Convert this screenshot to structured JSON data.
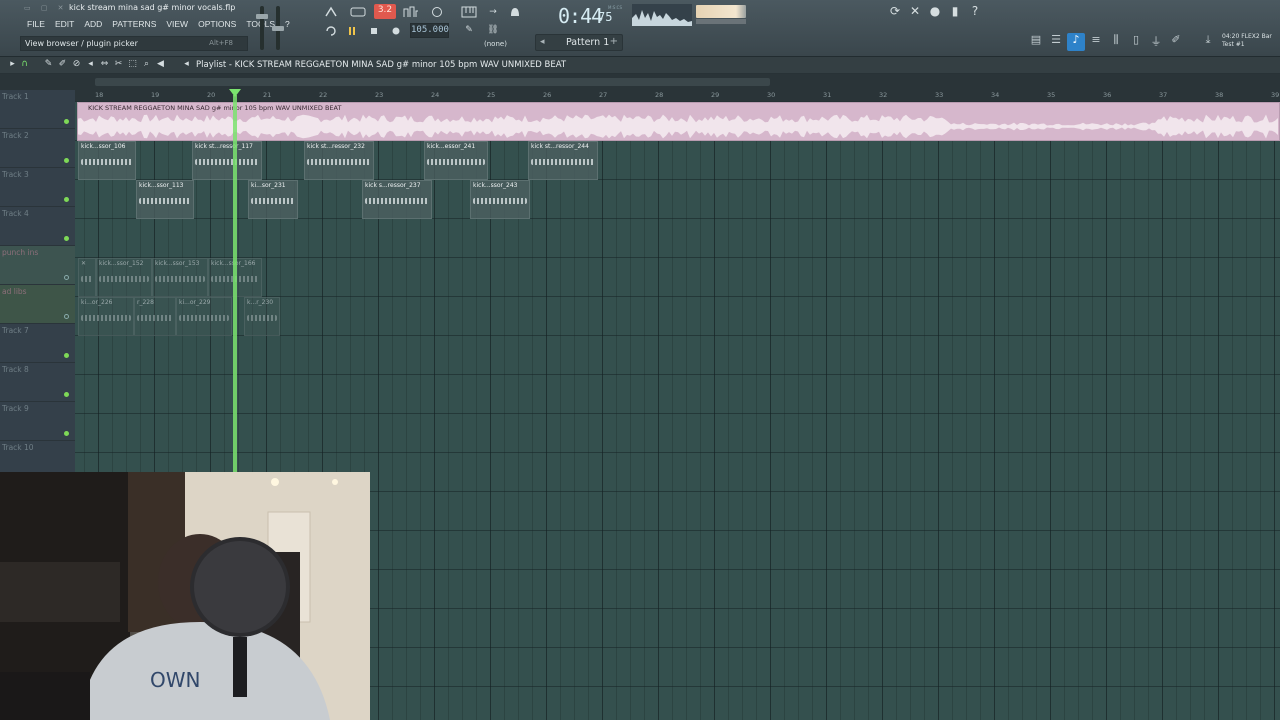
{
  "window": {
    "project_title": "kick stream mina sad g# minor vocals.flp"
  },
  "menu": [
    "FILE",
    "EDIT",
    "ADD",
    "PATTERNS",
    "VIEW",
    "OPTIONS",
    "TOOLS",
    "?"
  ],
  "hint": {
    "text": "View browser / plugin picker",
    "shortcut": "Alt+F8"
  },
  "transport": {
    "rec_count": "3.2",
    "tempo": "105.000",
    "time_main": "0:44",
    "time_ms": "75",
    "time_unit": "M:S:CS",
    "pattern": "Pattern 1",
    "none_label": "(none)"
  },
  "flex": {
    "line1": "04:20  FLEX2 Bar",
    "line2": "Test #1"
  },
  "playlist": {
    "title": "Playlist - KICK STREAM REGGAETON MINA SAD g# minor 105 bpm WAV UNMIXED BEAT",
    "main_clip_label": "KICK STREAM REGGAETON MINA SAD g# minor 105 bpm WAV UNMIXED BEAT",
    "bars": [
      "18",
      "19",
      "20",
      "21",
      "22",
      "23",
      "24",
      "25",
      "26",
      "27",
      "28",
      "29",
      "30",
      "31",
      "32",
      "33",
      "34",
      "35",
      "36",
      "37",
      "38",
      "39"
    ]
  },
  "tracks": [
    {
      "name": "Track 1"
    },
    {
      "name": "Track 2"
    },
    {
      "name": "Track 3"
    },
    {
      "name": "Track 4"
    },
    {
      "name": "punch ins"
    },
    {
      "name": "ad libs"
    },
    {
      "name": "Track 7"
    },
    {
      "name": "Track 8"
    },
    {
      "name": "Track 9"
    },
    {
      "name": "Track 10"
    }
  ],
  "clips": {
    "track2": [
      "kick...ssor_106",
      "kick st...ressor_117",
      "kick st...ressor_232",
      "kick...essor_241",
      "kick st...ressor_244"
    ],
    "track3": [
      "kick...ssor_113",
      "ki...sor_231",
      "kick s...ressor_237",
      "kick...ssor_243"
    ],
    "punch": [
      "kick...ssor_152",
      "kick...ssor_153",
      "kick...ssor_166"
    ],
    "adlibs": [
      "ki...or_226",
      "r_228",
      "ki...or_229",
      "k...r_230"
    ]
  },
  "colors": {
    "main_clip": "#d6b7cc",
    "playhead": "#7be36e",
    "active_tool": "#2e82c9",
    "rec": "#e0594e"
  }
}
